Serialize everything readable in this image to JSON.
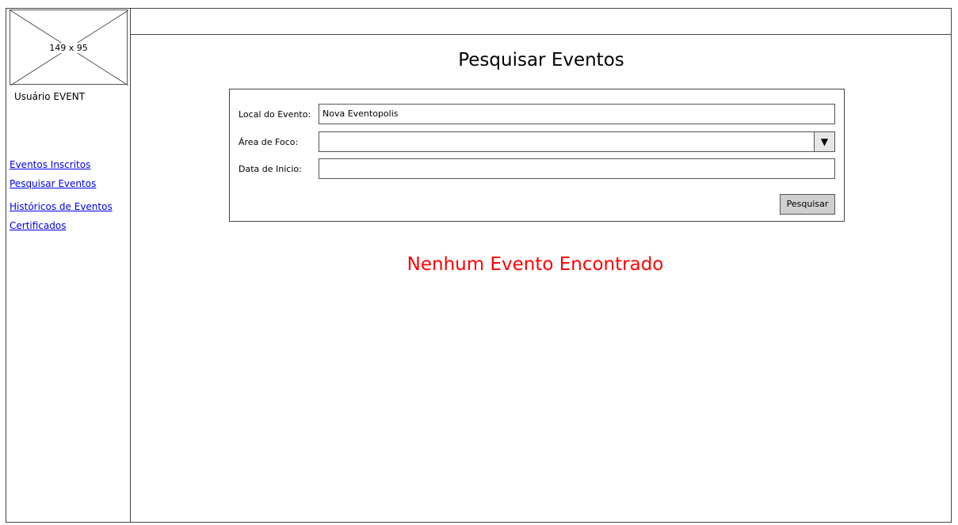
{
  "sidebar": {
    "logo_size_label": "149 x 95",
    "user_name": "Usuário EVENT",
    "nav": [
      {
        "label": "Eventos Inscritos"
      },
      {
        "label": "Pesquisar Eventos"
      },
      {
        "label": "Históricos de Eventos"
      },
      {
        "label": "Certificados"
      }
    ]
  },
  "main": {
    "title": "Pesquisar Eventos",
    "form": {
      "local_label": "Local do Evento:",
      "local_value": "Nova Eventopolis",
      "area_label": "Área de Foco:",
      "area_value": "",
      "data_label": "Data de Inicio:",
      "data_value": "",
      "submit_label": "Pesquisar"
    },
    "empty_message": "Nenhum Evento Encontrado"
  },
  "colors": {
    "link": "#0000ee",
    "empty_message": "#ff0000",
    "button_bg": "#cfcfcf"
  }
}
